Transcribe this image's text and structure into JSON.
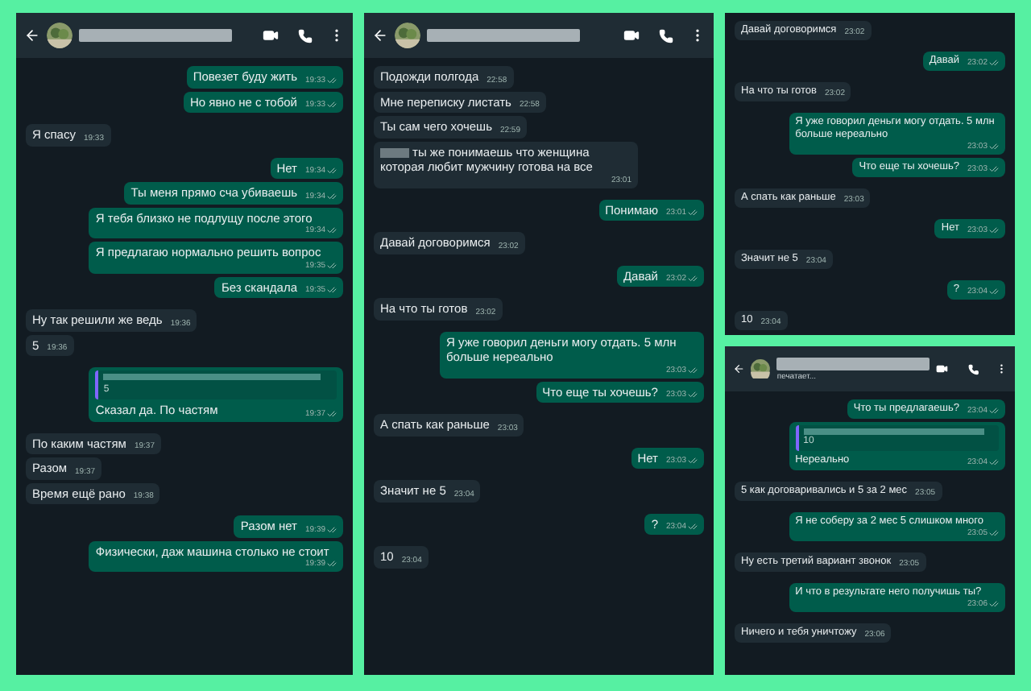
{
  "chats": [
    {
      "header_shown": true,
      "messages": [
        {
          "outgoing": true,
          "text": "Повезет буду жить",
          "time": "19:33"
        },
        {
          "outgoing": true,
          "text": "Но явно не с тобой",
          "time": "19:33"
        },
        {
          "outgoing": false,
          "text": "Я спасу",
          "time": "19:33"
        },
        {
          "outgoing": true,
          "text": "Нет",
          "time": "19:34"
        },
        {
          "outgoing": true,
          "text": "Ты меня прямо сча убиваешь",
          "time": "19:34"
        },
        {
          "outgoing": true,
          "text": "Я тебя близко не подлущу после этого",
          "time": "19:34"
        },
        {
          "outgoing": true,
          "text": "Я предлагаю нормально решить вопрос",
          "time": "19:35"
        },
        {
          "outgoing": true,
          "text": "Без скандала",
          "time": "19:35"
        },
        {
          "outgoing": false,
          "text": "Ну так решили же ведь",
          "time": "19:36"
        },
        {
          "outgoing": false,
          "text": "5",
          "time": "19:36"
        },
        {
          "outgoing": true,
          "text": "Сказал да. По частям",
          "time": "19:37",
          "quote": "5"
        },
        {
          "outgoing": false,
          "text": "По каким частям",
          "time": "19:37"
        },
        {
          "outgoing": false,
          "text": "Разом",
          "time": "19:37"
        },
        {
          "outgoing": false,
          "text": "Время ещё рано",
          "time": "19:38"
        },
        {
          "outgoing": true,
          "text": "Разом нет",
          "time": "19:39"
        },
        {
          "outgoing": true,
          "text": "Физически, даж машина столько не стоит",
          "time": "19:39"
        }
      ]
    },
    {
      "header_shown": true,
      "messages": [
        {
          "outgoing": false,
          "text": "Подожди полгода",
          "time": "22:58"
        },
        {
          "outgoing": false,
          "text": "Мне переписку листать",
          "time": "22:58"
        },
        {
          "outgoing": false,
          "text": "Ты сам чего хочешь",
          "time": "22:59"
        },
        {
          "outgoing": false,
          "text": "ты же понимаешь что женщина которая любит мужчину готова на все",
          "time": "23:01",
          "redacted_start": true
        },
        {
          "outgoing": true,
          "text": "Понимаю",
          "time": "23:01"
        },
        {
          "outgoing": false,
          "text": "Давай договоримся",
          "time": "23:02"
        },
        {
          "outgoing": true,
          "text": "Давай",
          "time": "23:02"
        },
        {
          "outgoing": false,
          "text": "На что ты готов",
          "time": "23:02"
        },
        {
          "outgoing": true,
          "text": "Я уже говорил деньги могу отдать. 5 млн больше нереально",
          "time": "23:03"
        },
        {
          "outgoing": true,
          "text": "Что еще ты хочешь?",
          "time": "23:03"
        },
        {
          "outgoing": false,
          "text": "А спать как раньше",
          "time": "23:03"
        },
        {
          "outgoing": true,
          "text": "Нет",
          "time": "23:03"
        },
        {
          "outgoing": false,
          "text": "Значит не 5",
          "time": "23:04"
        },
        {
          "outgoing": true,
          "text": "?",
          "time": "23:04"
        },
        {
          "outgoing": false,
          "text": "10",
          "time": "23:04"
        }
      ]
    },
    {
      "header_shown": false,
      "messages": [
        {
          "outgoing": false,
          "text": "Давай договоримся",
          "time": "23:02"
        },
        {
          "outgoing": true,
          "text": "Давай",
          "time": "23:02"
        },
        {
          "outgoing": false,
          "text": "На что ты готов",
          "time": "23:02"
        },
        {
          "outgoing": true,
          "text": "Я уже говорил деньги могу отдать. 5 млн больше нереально",
          "time": "23:03"
        },
        {
          "outgoing": true,
          "text": "Что еще ты хочешь?",
          "time": "23:03"
        },
        {
          "outgoing": false,
          "text": "А спать как раньше",
          "time": "23:03"
        },
        {
          "outgoing": true,
          "text": "Нет",
          "time": "23:03"
        },
        {
          "outgoing": false,
          "text": "Значит не 5",
          "time": "23:04"
        },
        {
          "outgoing": true,
          "text": "?",
          "time": "23:04"
        },
        {
          "outgoing": false,
          "text": "10",
          "time": "23:04"
        }
      ]
    },
    {
      "header_shown": true,
      "status": "печатает...",
      "messages": [
        {
          "outgoing": true,
          "text": "Что ты предлагаешь?",
          "time": "23:04"
        },
        {
          "outgoing": true,
          "text": "Нереально",
          "time": "23:04",
          "quote": "10"
        },
        {
          "outgoing": false,
          "text": "5 как договаривались и 5 за 2 мес",
          "time": "23:05"
        },
        {
          "outgoing": true,
          "text": "Я не соберу за 2 мес 5 слишком много",
          "time": "23:05"
        },
        {
          "outgoing": false,
          "text": "Ну есть третий вариант звонок",
          "time": "23:05"
        },
        {
          "outgoing": true,
          "text": "И что в результате него получишь ты?",
          "time": "23:06"
        },
        {
          "outgoing": false,
          "text": "Ничего и тебя уничтожу",
          "time": "23:06"
        }
      ]
    }
  ]
}
